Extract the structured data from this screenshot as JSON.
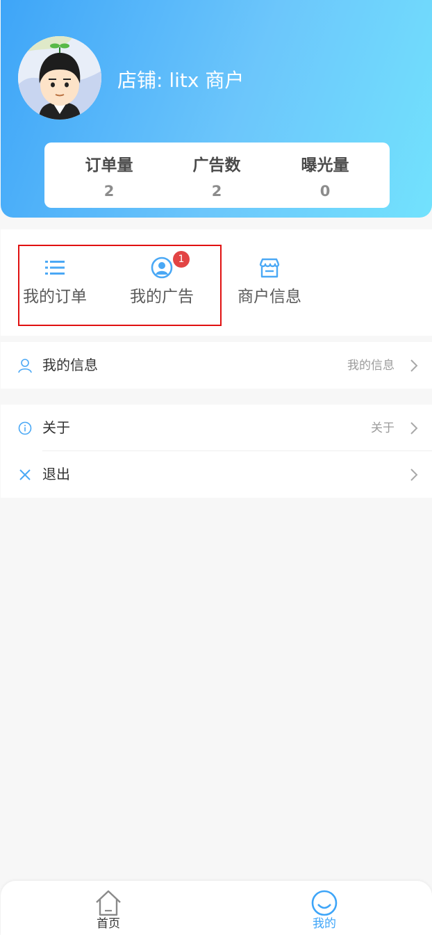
{
  "header": {
    "store_name": "店铺:  litx 商户",
    "stats": [
      {
        "label": "订单量",
        "value": "2"
      },
      {
        "label": "广告数",
        "value": "2"
      },
      {
        "label": "曝光量",
        "value": "0"
      }
    ]
  },
  "quick_menu": {
    "items": [
      {
        "label": "我的订单",
        "icon": "list-icon"
      },
      {
        "label": "我的广告",
        "icon": "user-circle-icon",
        "badge": "1"
      },
      {
        "label": "商户信息",
        "icon": "shop-icon"
      }
    ]
  },
  "list": {
    "my_info": {
      "label": "我的信息",
      "value": "我的信息",
      "icon": "user-icon"
    },
    "about": {
      "label": "关于",
      "value": "关于",
      "icon": "info-icon"
    },
    "logout": {
      "label": "退出",
      "icon": "close-icon"
    }
  },
  "tabbar": {
    "home": {
      "label": "首页",
      "icon": "home-icon"
    },
    "mine": {
      "label": "我的",
      "icon": "smile-icon"
    }
  },
  "colors": {
    "primary": "#3ea5f8",
    "accent": "#4aa8f5",
    "badge": "#e24444",
    "highlight": "#e01010"
  }
}
